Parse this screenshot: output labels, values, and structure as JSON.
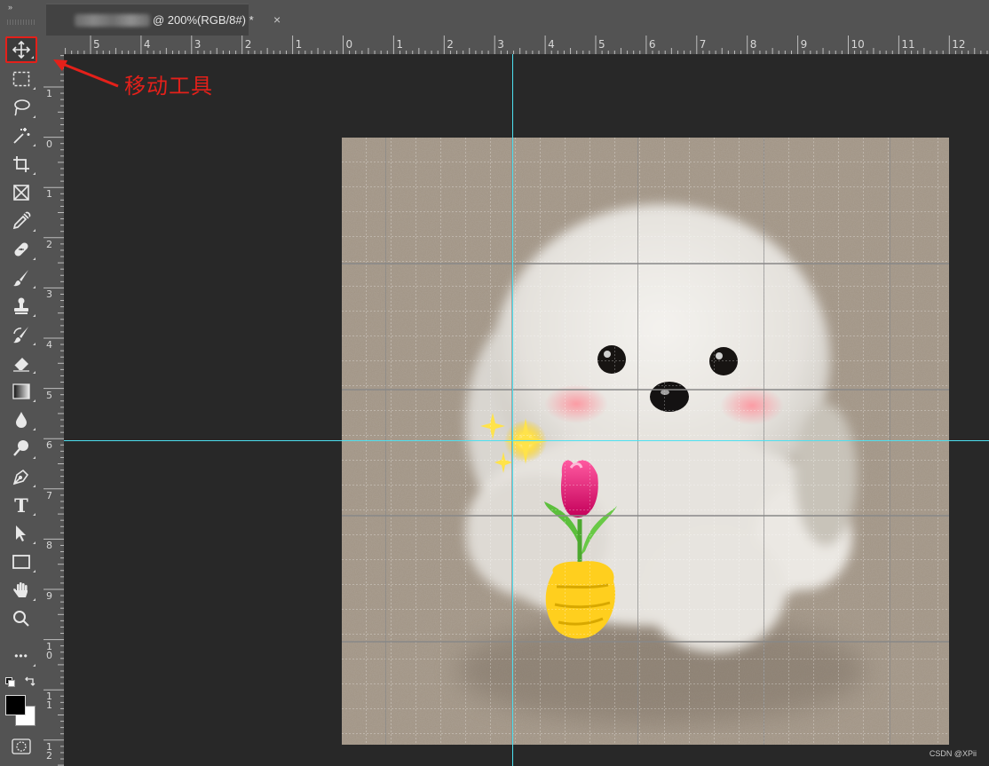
{
  "document_tab": {
    "title": "@ 200%(RGB/8#) *",
    "close_glyph": "×"
  },
  "panel_collapse_glyph": "»",
  "toolbar": {
    "tools": [
      {
        "name": "move-tool",
        "icon": "move-icon",
        "selected": true
      },
      {
        "name": "rectangular-marquee-tool",
        "icon": "marquee-icon"
      },
      {
        "name": "lasso-tool",
        "icon": "lasso-icon"
      },
      {
        "name": "magic-wand-tool",
        "icon": "magic-wand-icon"
      },
      {
        "name": "crop-tool",
        "icon": "crop-icon"
      },
      {
        "name": "frame-tool",
        "icon": "frame-icon"
      },
      {
        "name": "eyedropper-tool",
        "icon": "eyedropper-icon"
      },
      {
        "name": "healing-brush-tool",
        "icon": "bandage-icon"
      },
      {
        "name": "brush-tool",
        "icon": "brush-icon"
      },
      {
        "name": "clone-stamp-tool",
        "icon": "stamp-icon"
      },
      {
        "name": "history-brush-tool",
        "icon": "history-brush-icon"
      },
      {
        "name": "eraser-tool",
        "icon": "eraser-icon"
      },
      {
        "name": "gradient-tool",
        "icon": "gradient-icon"
      },
      {
        "name": "blur-tool",
        "icon": "drop-icon"
      },
      {
        "name": "dodge-tool",
        "icon": "dodge-icon"
      },
      {
        "name": "pen-tool",
        "icon": "pen-icon"
      },
      {
        "name": "type-tool",
        "icon": "type-icon",
        "glyph": "T"
      },
      {
        "name": "path-selection-tool",
        "icon": "arrow-icon"
      },
      {
        "name": "rectangle-tool",
        "icon": "rectangle-icon"
      },
      {
        "name": "hand-tool",
        "icon": "hand-icon"
      },
      {
        "name": "zoom-tool",
        "icon": "zoom-icon"
      },
      {
        "name": "edit-toolbar",
        "icon": "more-icon",
        "glyph": "•••"
      }
    ],
    "foreground_color": "#000000",
    "background_color": "#ffffff"
  },
  "rulers": {
    "horizontal_labels": [
      "5",
      "4",
      "3",
      "2",
      "1",
      "0",
      "1",
      "2",
      "3",
      "4",
      "5",
      "6",
      "7",
      "8",
      "9",
      "10",
      "11",
      "12"
    ],
    "vertical_labels": [
      "1",
      "0",
      "1",
      "2",
      "3",
      "4",
      "5",
      "6",
      "7",
      "8",
      "9",
      "10",
      "11",
      "12"
    ]
  },
  "annotation": {
    "label": "移动工具",
    "color": "#e4201a"
  },
  "guide_color": "#4de0f0",
  "watermark": "CSDN @XPii"
}
